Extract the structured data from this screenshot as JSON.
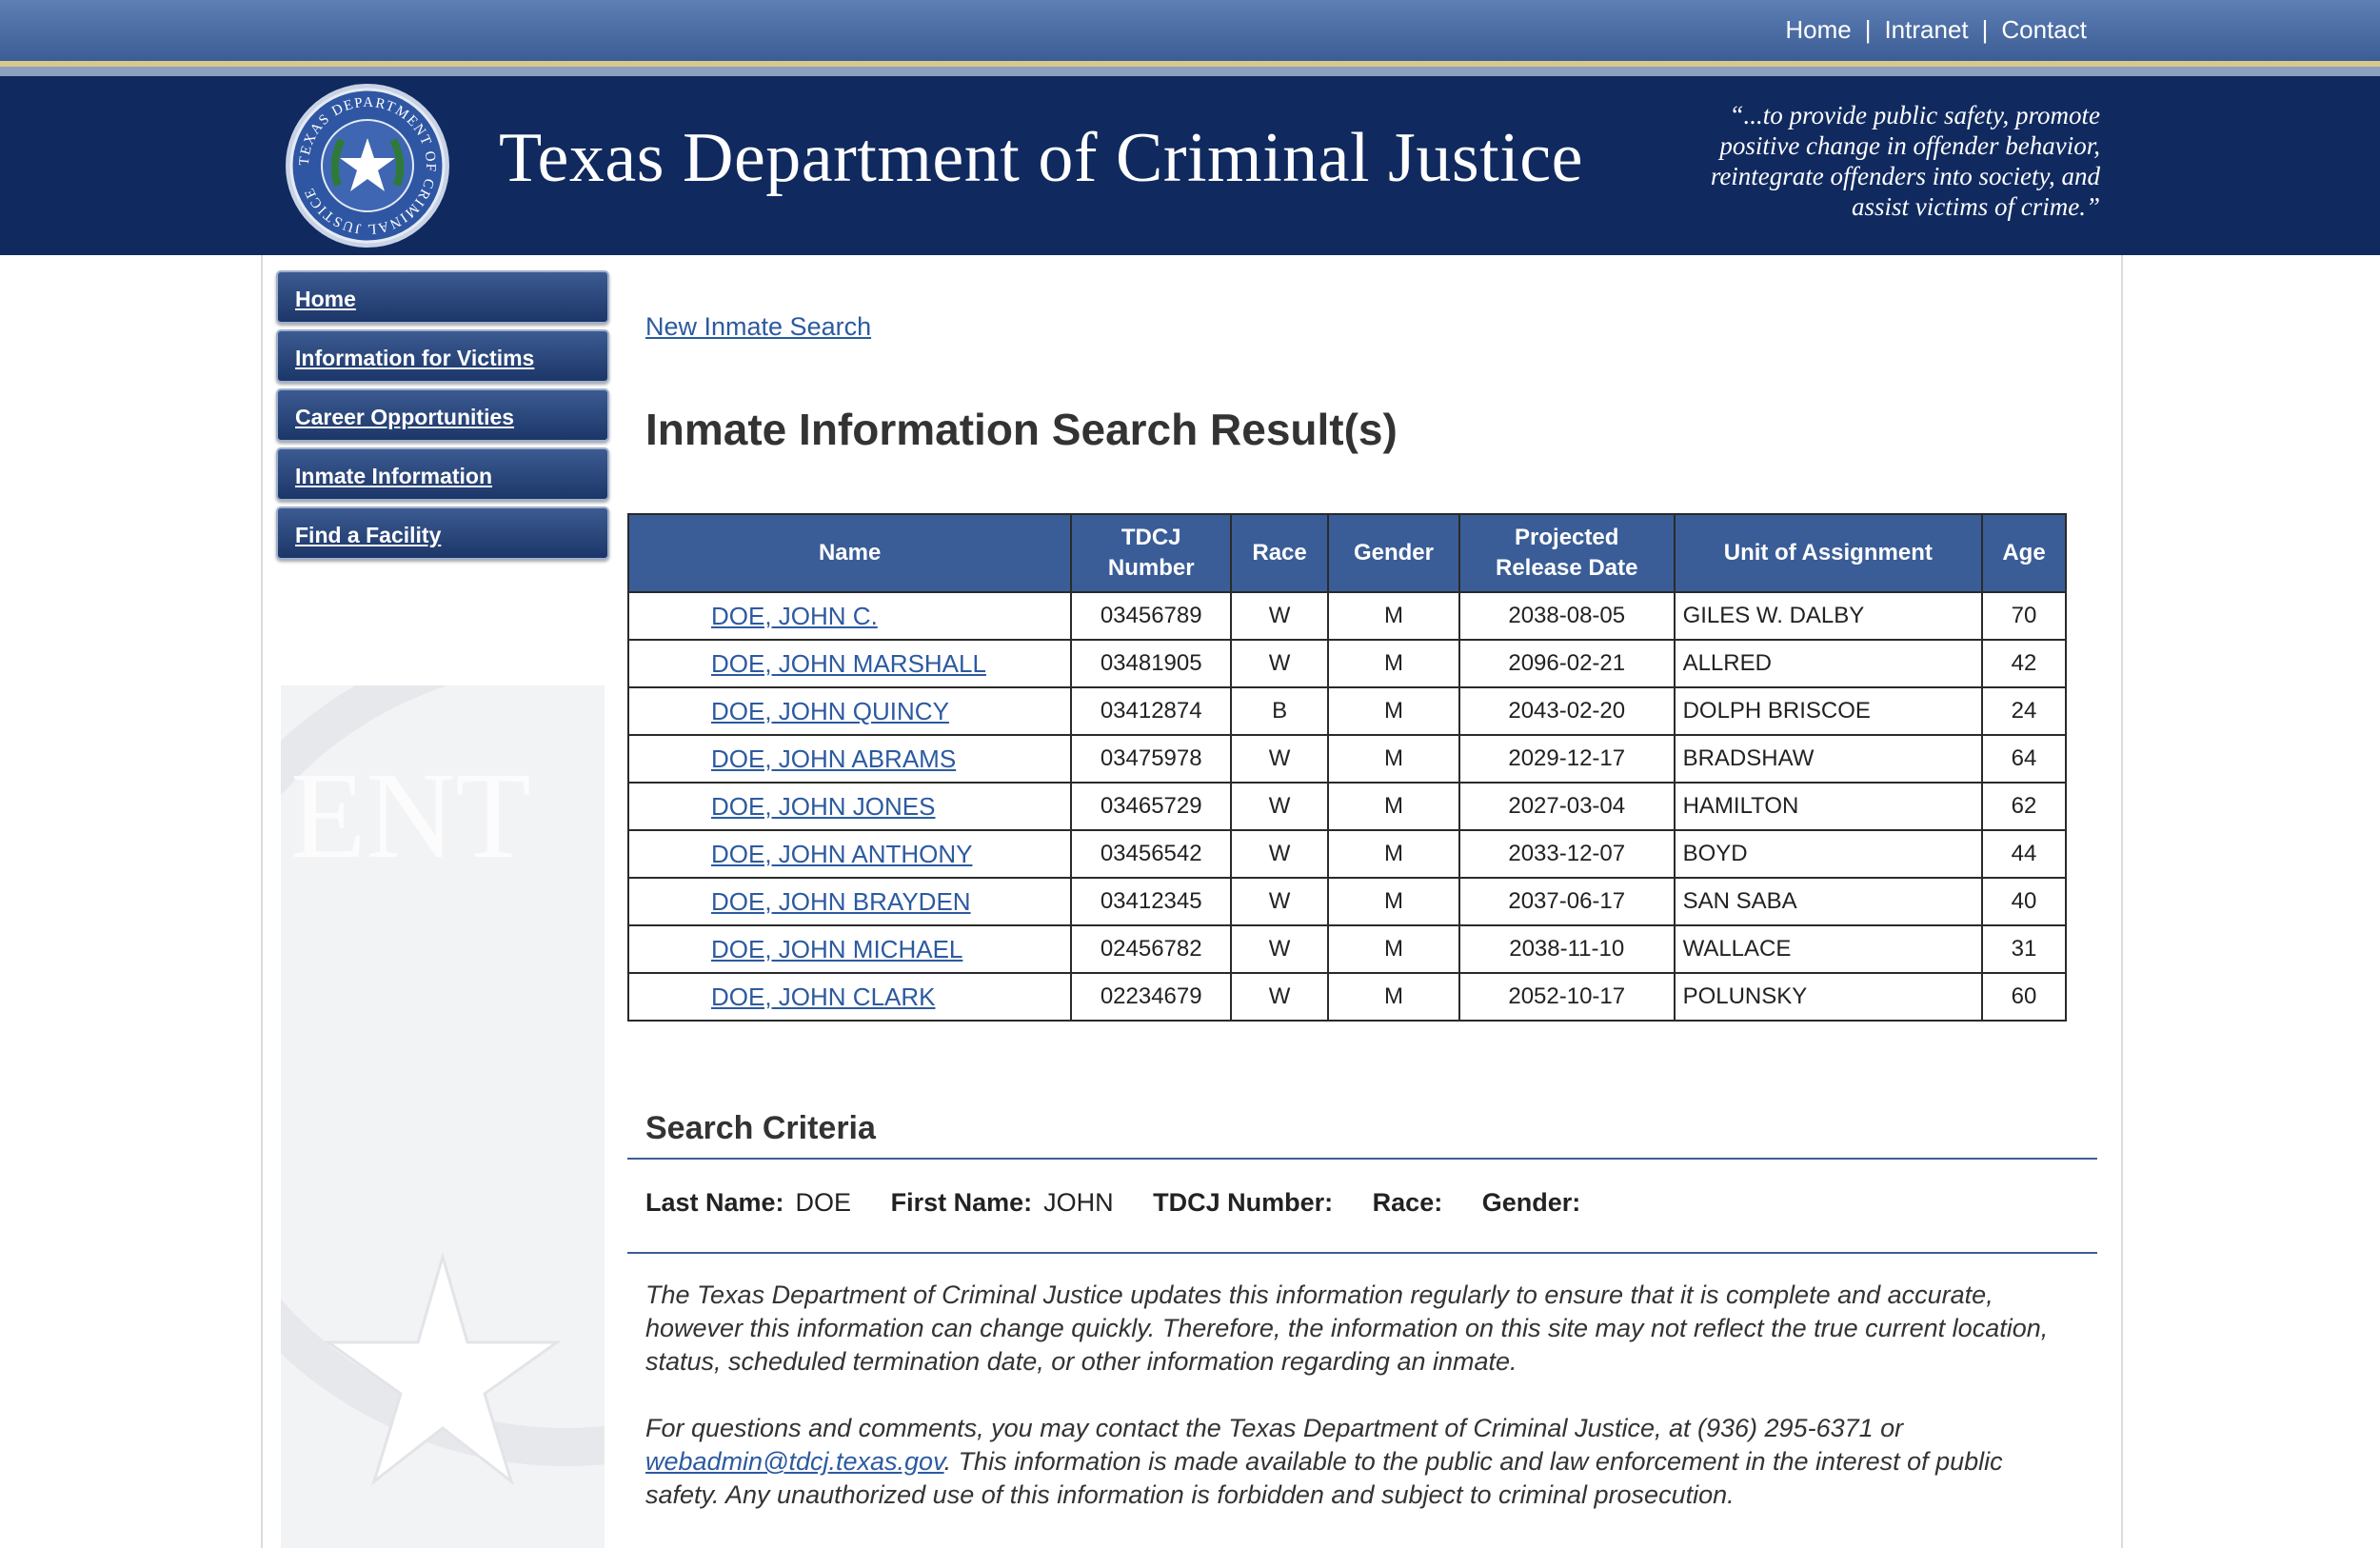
{
  "top_nav": {
    "home": "Home",
    "sep1": "|",
    "intranet": "Intranet",
    "sep2": "|",
    "contact": "Contact"
  },
  "header": {
    "title": "Texas Department of Criminal Justice",
    "motto": "“...to provide public safety, promote positive change in offender behavior, reintegrate offenders into society, and assist victims of crime.”",
    "seal_text": "TEXAS DEPARTMENT OF CRIMINAL JUSTICE"
  },
  "sidebar": {
    "items": [
      {
        "label": "Home"
      },
      {
        "label": "Information for Victims"
      },
      {
        "label": "Career Opportunities"
      },
      {
        "label": "Inmate Information"
      },
      {
        "label": "Find a Facility"
      }
    ]
  },
  "main": {
    "new_search_link": "New Inmate Search",
    "page_title": "Inmate Information Search Result(s)",
    "table": {
      "headers": {
        "name": "Name",
        "tdcj_1": "TDCJ",
        "tdcj_2": "Number",
        "race": "Race",
        "gender": "Gender",
        "release_1": "Projected",
        "release_2": "Release Date",
        "unit": "Unit of Assignment",
        "age": "Age"
      },
      "rows": [
        {
          "name": "DOE, JOHN C.",
          "tdcj": "03456789",
          "race": "W",
          "gender": "M",
          "release": "2038-08-05",
          "unit": "GILES W. DALBY",
          "age": "70"
        },
        {
          "name": "DOE, JOHN MARSHALL",
          "tdcj": "03481905",
          "race": "W",
          "gender": "M",
          "release": "2096-02-21",
          "unit": "ALLRED",
          "age": "42"
        },
        {
          "name": "DOE, JOHN QUINCY",
          "tdcj": "03412874",
          "race": "B",
          "gender": "M",
          "release": "2043-02-20",
          "unit": "DOLPH BRISCOE",
          "age": "24"
        },
        {
          "name": "DOE, JOHN ABRAMS",
          "tdcj": "03475978",
          "race": "W",
          "gender": "M",
          "release": "2029-12-17",
          "unit": "BRADSHAW",
          "age": "64"
        },
        {
          "name": "DOE, JOHN JONES",
          "tdcj": "03465729",
          "race": "W",
          "gender": "M",
          "release": "2027-03-04",
          "unit": "HAMILTON",
          "age": "62"
        },
        {
          "name": "DOE, JOHN ANTHONY",
          "tdcj": "03456542",
          "race": "W",
          "gender": "M",
          "release": "2033-12-07",
          "unit": "BOYD",
          "age": "44"
        },
        {
          "name": "DOE, JOHN BRAYDEN",
          "tdcj": "03412345",
          "race": "W",
          "gender": "M",
          "release": "2037-06-17",
          "unit": "SAN SABA",
          "age": "40"
        },
        {
          "name": "DOE, JOHN MICHAEL",
          "tdcj": "02456782",
          "race": "W",
          "gender": "M",
          "release": "2038-11-10",
          "unit": "WALLACE",
          "age": "31"
        },
        {
          "name": "DOE, JOHN CLARK",
          "tdcj": "02234679",
          "race": "W",
          "gender": "M",
          "release": "2052-10-17",
          "unit": "POLUNSKY",
          "age": "60"
        }
      ]
    },
    "criteria": {
      "heading": "Search Criteria",
      "last_name_label": "Last Name:",
      "last_name_value": "DOE",
      "first_name_label": "First Name:",
      "first_name_value": "JOHN",
      "tdcj_label": "TDCJ Number:",
      "race_label": "Race:",
      "gender_label": "Gender:"
    },
    "disclaimer": {
      "para1": "The Texas Department of Criminal Justice updates this information regularly to ensure that it is complete and accurate, however this information can change quickly. Therefore, the information on this site may not reflect the true current location, status, scheduled termination date, or other information regarding an inmate.",
      "para2_before": "For questions and comments, you may contact the Texas Department of Criminal Justice, at (936) 295-6371 or ",
      "email": "webadmin@tdcj.texas.gov",
      "para2_after": ". This information is made available to the public and law enforcement in the interest of public safety. Any unauthorized use of this information is forbidden and subject to criminal prosecution."
    }
  },
  "colors": {
    "header_bg": "#102a5f",
    "table_header_bg": "#3a5d98",
    "link": "#2c5aa0",
    "nav_button": "#1c3668"
  },
  "icons": {
    "seal": "tdcj-seal-icon",
    "star": "star-icon"
  }
}
